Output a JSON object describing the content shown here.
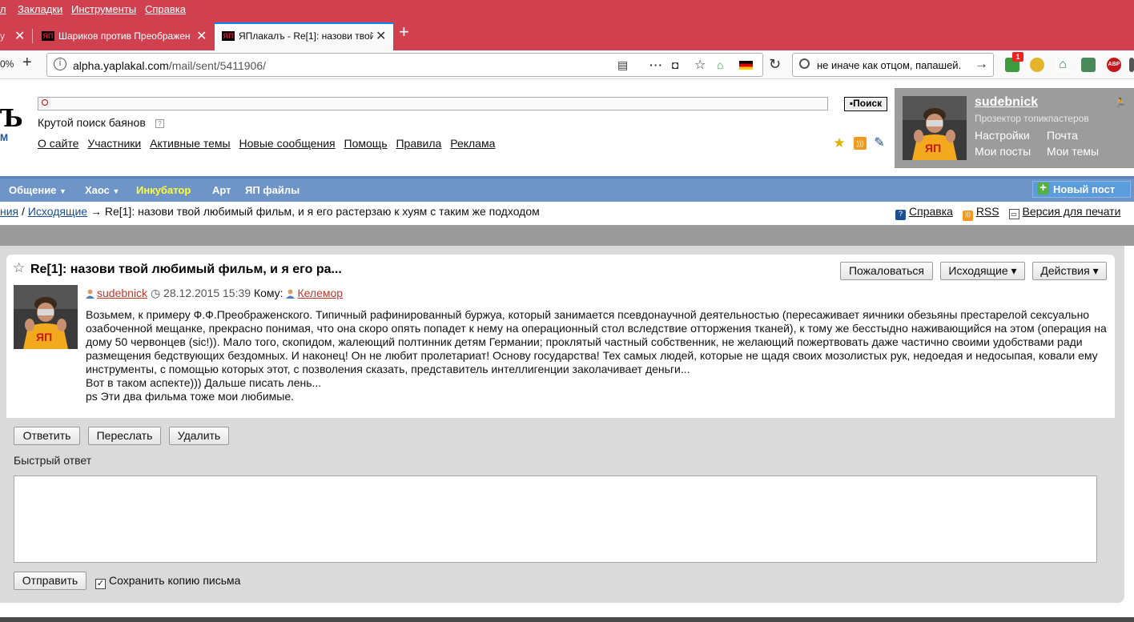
{
  "browser": {
    "menu": [
      "л",
      "Закладки",
      "Инструменты",
      "Справка"
    ],
    "tabs": [
      {
        "title": "у",
        "active": false
      },
      {
        "title": "Шариков против Преображен",
        "active": false
      },
      {
        "title": "ЯПлакалъ - Re[1]: назови твой",
        "active": true
      }
    ],
    "zoom": "0%",
    "url_host": "alpha.yaplakal.com",
    "url_path": "/mail/sent/5411906/",
    "search_value": "не иначе как отцом, папашей.",
    "ext_badge": "1",
    "abp_label": "ABP"
  },
  "site": {
    "logo_part": "Ъ",
    "logo_sub": "М",
    "search_button": "Поиск",
    "bayan_search": "Крутой поиск баянов",
    "links": [
      "О сайте",
      "Участники",
      "Активные темы",
      "Новые сообщения",
      "Помощь",
      "Правила",
      "Реклама"
    ]
  },
  "user": {
    "name": "sudebnick",
    "rank": "Прозектор топикпастеров",
    "settings": "Настройки",
    "mail": "Почта",
    "my_posts": "Мои посты",
    "my_topics": "Мои темы"
  },
  "nav": {
    "items": [
      {
        "label": "Общение",
        "dropdown": true
      },
      {
        "label": "Хаос",
        "dropdown": true
      },
      {
        "label": "Инкубатор",
        "highlight": true
      },
      {
        "label": "Арт"
      },
      {
        "label": "ЯП файлы"
      }
    ],
    "new_post": "Новый пост"
  },
  "breadcrumb": {
    "part1": "ния",
    "sep1": "/",
    "part2": "Исходящие",
    "arrow": "→",
    "current": "Re[1]: назови твой любимый фильм, и я его растерзаю к хуям с таким же подходом",
    "help": "Справка",
    "rss": "RSS",
    "print": "Версия для печати"
  },
  "message": {
    "title": "Re[1]: назови твой любимый фильм, и я его ра...",
    "report_btn": "Пожаловаться",
    "folder_btn": "Исходящие ▾",
    "actions_btn": "Действия ▾",
    "author": "sudebnick",
    "date": "28.12.2015 15:39",
    "to_label": "Кому:",
    "recipient": "Келемор",
    "body": [
      "Возьмем, к примеру Ф.Ф.Преображенского. Типичный рафинированный буржуа, который занимается псевдонаучной деятельностью (пересаживает яичники обезьяны престарелой сексуально озабоченной мещанке, прекрасно понимая, что она скоро опять попадет к нему на операционный стол вследствие отторжения тканей), к тому же бесстыдно наживающийся на этом (операция на дому 50 червонцев (sic!)). Мало того, скопидом, жалеющий полтинник детям Германии; проклятый частный собственник, не желающий пожертвовать даже частично своими удобствами ради размещения бедствующих бездомных. И наконец! Он не любит пролетариат! Основу государства! Тех самых людей, которые не щадя своих мозолистых рук, недоедая и недосыпая, ковали ему инструменты, с помощью которых этот, с позволения сказать, представитель интеллигенции заколачивает деньги...",
      "Вот в таком аспекте))) Дальше писать лень...",
      "ps Эти два фильма тоже мои любимые."
    ]
  },
  "actions": {
    "reply": "Ответить",
    "forward": "Переслать",
    "delete": "Удалить"
  },
  "quick_reply": {
    "label": "Быстрый ответ",
    "value": "",
    "send": "Отправить",
    "save_copy": "Сохранить копию письма",
    "save_copy_checked": true
  }
}
